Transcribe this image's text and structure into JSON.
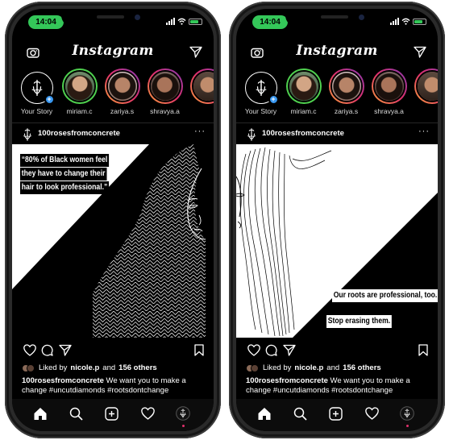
{
  "colors": {
    "status_pill": "#34c759",
    "story_gradient": [
      "#f9a13a",
      "#e1306c",
      "#833ab4"
    ],
    "close_friends_ring": "#4fd14f",
    "add_badge": "#3897f0",
    "notification_dot": "#e1306c"
  },
  "icons": {
    "camera": "camera-icon",
    "direct": "paper-plane-icon",
    "more": "more-icon",
    "like": "heart-icon",
    "comment": "comment-icon",
    "share": "paper-plane-icon",
    "save": "bookmark-icon",
    "nav": [
      "home-icon",
      "search-icon",
      "add-post-icon",
      "activity-heart-icon",
      "profile-icon"
    ]
  },
  "phones": [
    {
      "status": {
        "time": "14:04"
      },
      "app_title": "Instagram",
      "stories": [
        {
          "name": "Your Story"
        },
        {
          "name": "miriam.c"
        },
        {
          "name": "zariya.s"
        },
        {
          "name": "shravya.a"
        },
        {
          "name": ""
        }
      ],
      "post": {
        "username": "100rosesfromconcrete",
        "more": "···",
        "image_text": [
          "“80% of Black women feel",
          "they have to change their",
          "hair to look professional.”"
        ],
        "likes": {
          "prefix": "Liked by ",
          "user": "nicole.p",
          "middle": " and ",
          "others": "156 others"
        },
        "caption": {
          "username": "100rosesfromconcrete",
          "text": "  We want you to make a change #uncutdiamonds #rootsdontchange"
        }
      }
    },
    {
      "status": {
        "time": "14:04"
      },
      "app_title": "Instagram",
      "stories": [
        {
          "name": "Your Story"
        },
        {
          "name": "miriam.c"
        },
        {
          "name": "zariya.s"
        },
        {
          "name": "shravya.a"
        },
        {
          "name": ""
        }
      ],
      "post": {
        "username": "100rosesfromconcrete",
        "more": "···",
        "image_text": [
          "Our roots are professional, too.",
          "Stop erasing them."
        ],
        "likes": {
          "prefix": "Liked by ",
          "user": "nicole.p",
          "middle": " and ",
          "others": "156 others"
        },
        "caption": {
          "username": "100rosesfromconcrete",
          "text": "  We want you to make a change #uncutdiamonds #rootsdontchange"
        }
      }
    }
  ]
}
